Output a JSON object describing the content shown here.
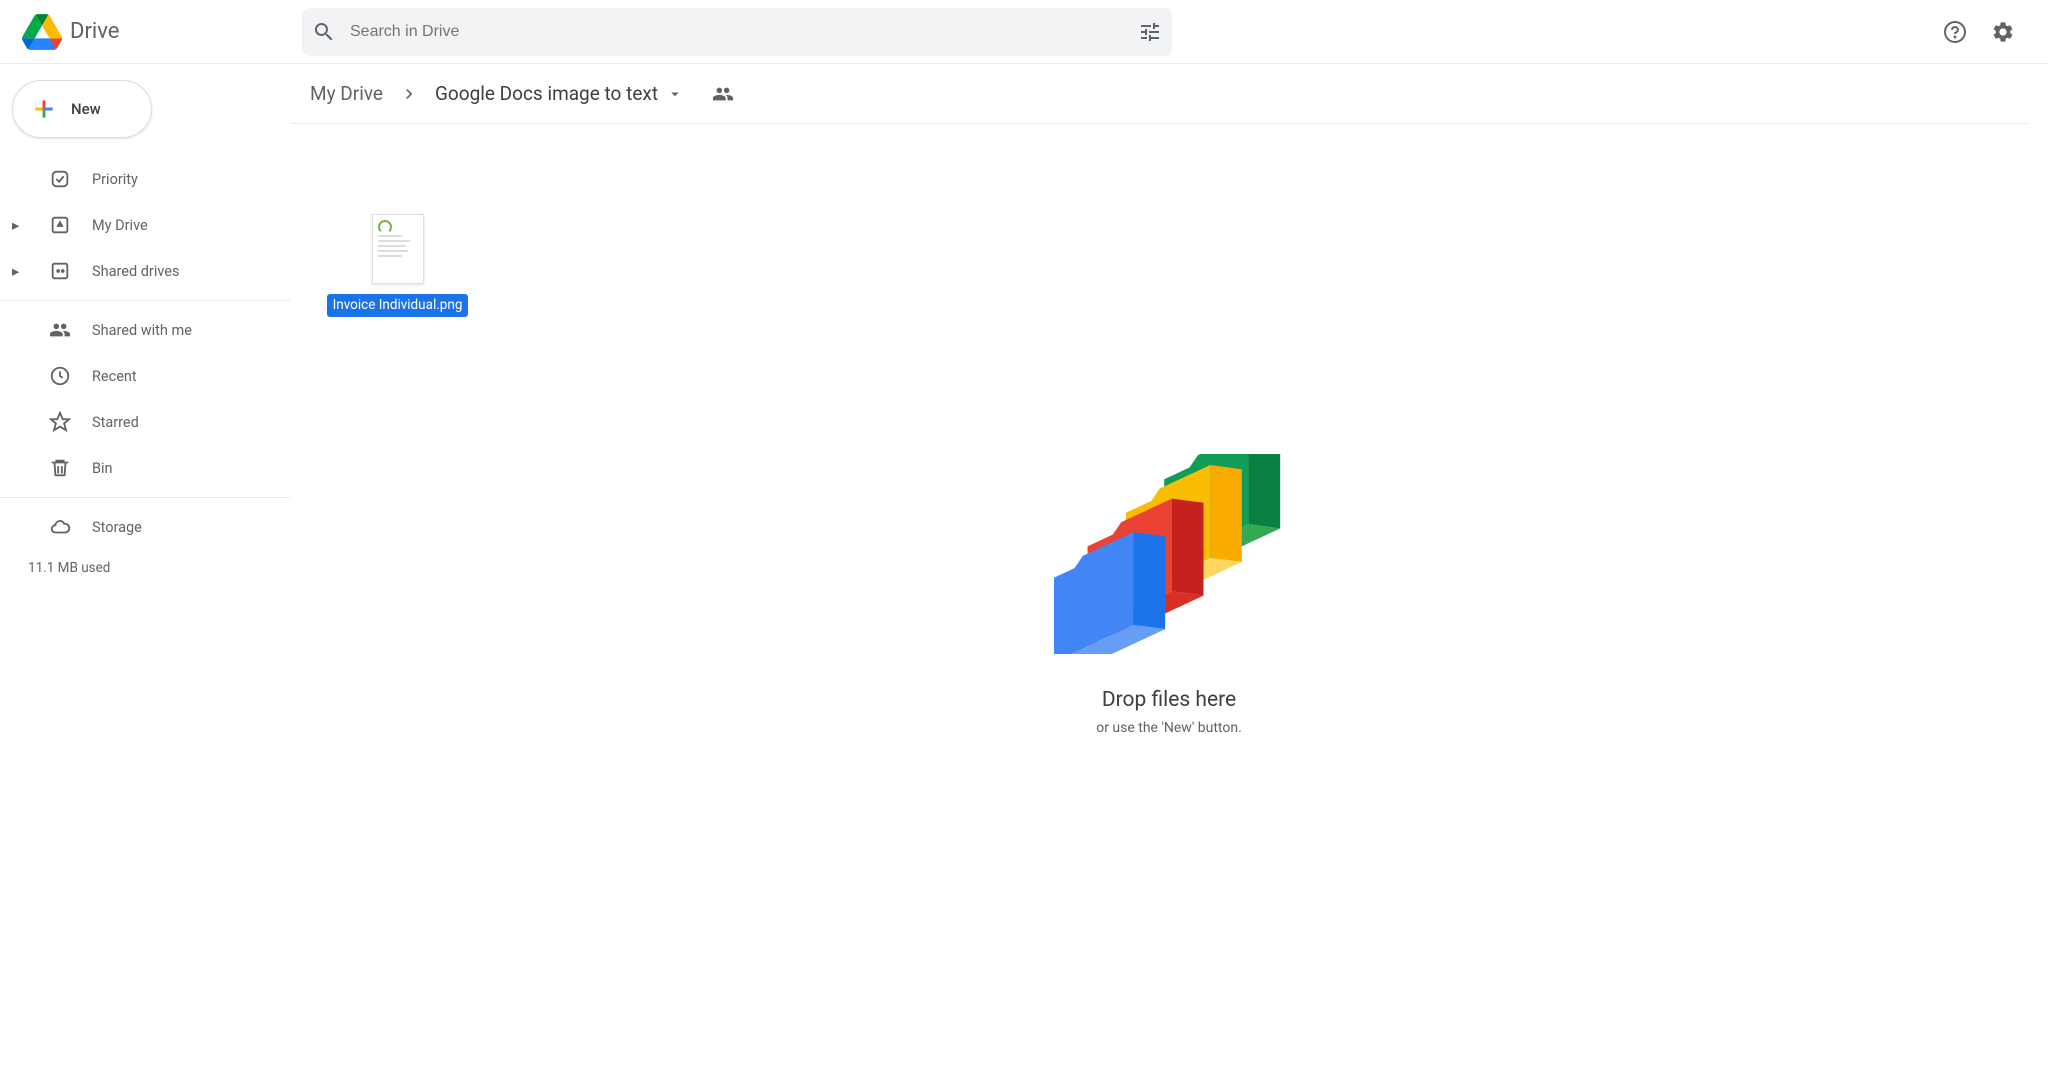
{
  "header": {
    "app_name": "Drive",
    "search_placeholder": "Search in Drive"
  },
  "sidebar": {
    "new_label": "New",
    "items": [
      {
        "label": "Priority",
        "icon": "priority",
        "expandable": false
      },
      {
        "label": "My Drive",
        "icon": "mydrive",
        "expandable": true
      },
      {
        "label": "Shared drives",
        "icon": "shareddrives",
        "expandable": true
      }
    ],
    "items2": [
      {
        "label": "Shared with me",
        "icon": "shared"
      },
      {
        "label": "Recent",
        "icon": "recent"
      },
      {
        "label": "Starred",
        "icon": "starred"
      },
      {
        "label": "Bin",
        "icon": "bin"
      }
    ],
    "storage_label": "Storage",
    "storage_used": "11.1 MB used"
  },
  "breadcrumbs": {
    "root": "My Drive",
    "current": "Google Docs image to text"
  },
  "files": [
    {
      "name": "Invoice Individual.png",
      "selected": true
    }
  ],
  "dropzone": {
    "title": "Drop files here",
    "subtitle": "or use the 'New' button."
  }
}
